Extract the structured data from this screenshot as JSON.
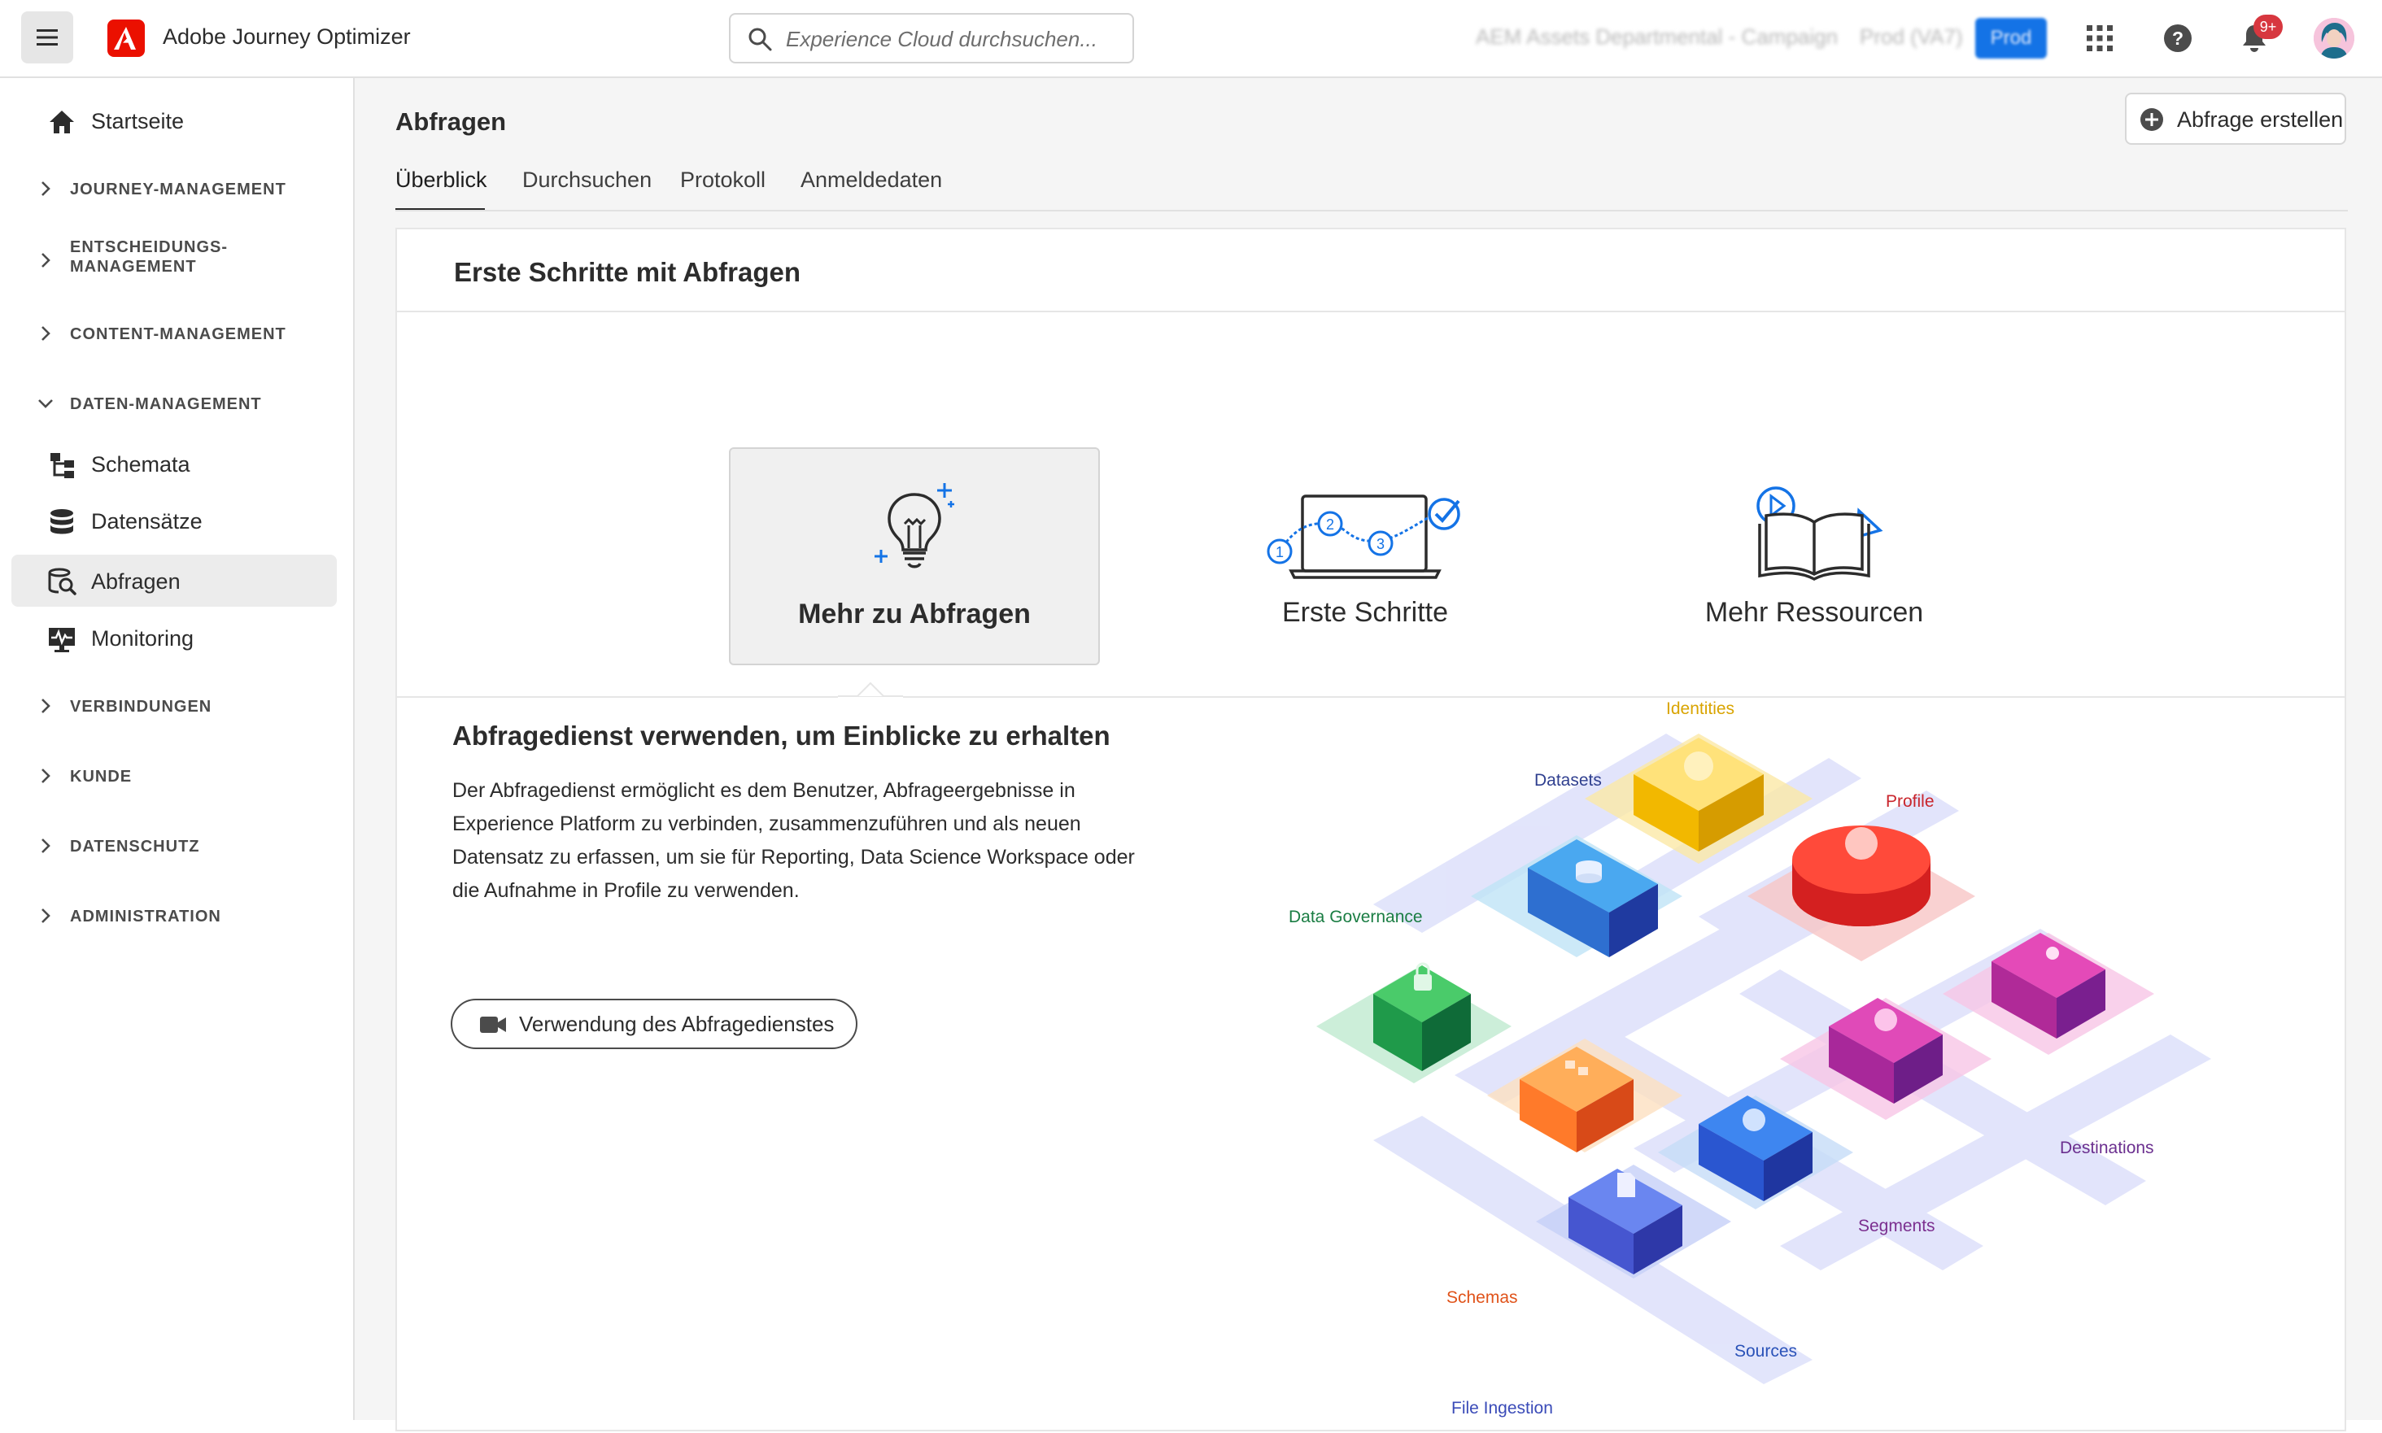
{
  "topbar": {
    "app_title": "Adobe Journey Optimizer",
    "search_placeholder": "Experience Cloud durchsuchen...",
    "org_name": "AEM Assets Departmental - Campaign",
    "sandbox_name": "Prod (VA7)",
    "sandbox_badge": "Prod",
    "notification_count": "9+",
    "icons": [
      "menu-icon",
      "adobe-logo-icon",
      "search-icon",
      "app-switcher-icon",
      "help-icon",
      "bell-icon",
      "avatar"
    ],
    "brand_color": "#eb1000",
    "accent_color": "#1473e6"
  },
  "sidebar": {
    "items": [
      {
        "type": "link",
        "label": "Startseite",
        "icon": "home-icon"
      },
      {
        "type": "section",
        "label": "JOURNEY-MANAGEMENT",
        "expanded": false
      },
      {
        "type": "section",
        "label_line1": "ENTSCHEIDUNGS-",
        "label_line2": "MANAGEMENT",
        "expanded": false
      },
      {
        "type": "section",
        "label": "CONTENT-MANAGEMENT",
        "expanded": false
      },
      {
        "type": "section",
        "label": "DATEN-MANAGEMENT",
        "expanded": true
      },
      {
        "type": "link",
        "label": "Schemata",
        "icon": "schema-icon"
      },
      {
        "type": "link",
        "label": "Datensätze",
        "icon": "dataset-icon"
      },
      {
        "type": "link",
        "label": "Abfragen",
        "icon": "query-icon",
        "selected": true
      },
      {
        "type": "link",
        "label": "Monitoring",
        "icon": "monitoring-icon"
      },
      {
        "type": "section",
        "label": "VERBINDUNGEN",
        "expanded": false
      },
      {
        "type": "section",
        "label": "KUNDE",
        "expanded": false
      },
      {
        "type": "section",
        "label": "DATENSCHUTZ",
        "expanded": false
      },
      {
        "type": "section",
        "label": "ADMINISTRATION",
        "expanded": false
      }
    ]
  },
  "main": {
    "title": "Abfragen",
    "create_button": "Abfrage erstellen",
    "tabs": [
      {
        "label": "Überblick",
        "active": true
      },
      {
        "label": "Durchsuchen",
        "active": false
      },
      {
        "label": "Protokoll",
        "active": false
      },
      {
        "label": "Anmeldedaten",
        "active": false
      }
    ],
    "card": {
      "title": "Erste Schritte mit Abfragen",
      "tiles": [
        {
          "label": "Mehr zu Abfragen",
          "icon": "lightbulb-icon",
          "active": true
        },
        {
          "label": "Erste Schritte",
          "icon": "laptop-steps-icon",
          "active": false
        },
        {
          "label": "Mehr Ressourcen",
          "icon": "book-play-icon",
          "active": false
        }
      ],
      "section_title": "Abfragedienst verwenden, um Einblicke zu erhalten",
      "section_body": "Der Abfragedienst ermöglicht es dem Benutzer, Abfrageergebnisse in Experience Platform zu verbinden, zusammenzuführen und als neuen Datensatz zu erfassen, um sie für Reporting, Data Science Workspace oder die Aufnahme in Profile zu verwenden.",
      "video_button": "Verwendung des Abfragedienstes",
      "illustration_labels": {
        "identities": "Identities",
        "datasets": "Datasets",
        "profile": "Profile",
        "data_governance": "Data Governance",
        "destinations": "Destinations",
        "segments": "Segments",
        "schemas": "Schemas",
        "sources": "Sources",
        "file_ingestion": "File Ingestion"
      },
      "label_colors": {
        "identities": "#d9a400",
        "datasets": "#2f3f8f",
        "profile": "#c9252c",
        "data_governance": "#1a7d43",
        "destinations": "#6b2f8f",
        "segments": "#7b2f8f",
        "schemas": "#e0531a",
        "sources": "#2a52b8",
        "file_ingestion": "#3a4bb8"
      }
    }
  }
}
